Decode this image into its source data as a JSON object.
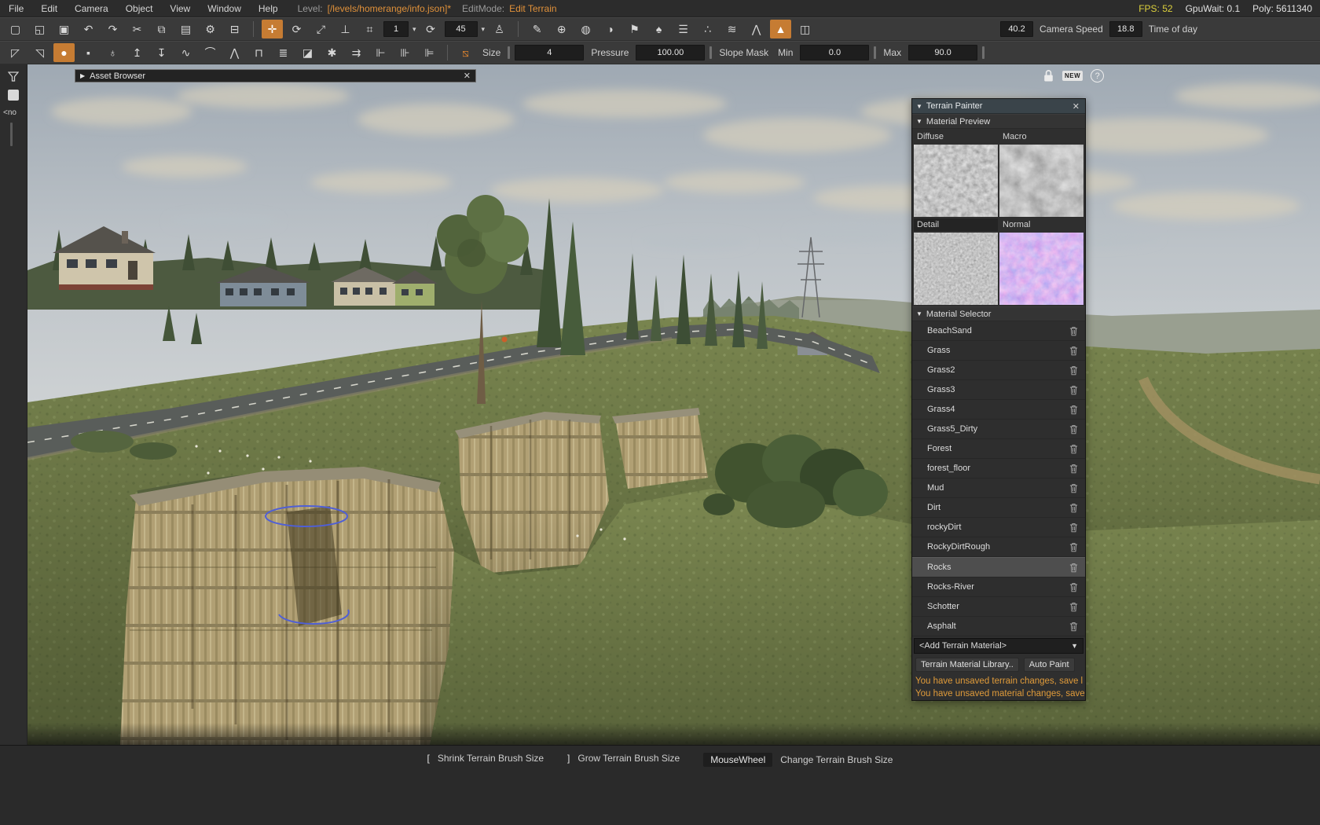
{
  "glyphs": {
    "caret_down": "▾",
    "triangle_right": "▶",
    "triangle_down": "▼",
    "close": "✕"
  },
  "menubar": {
    "items": [
      "File",
      "Edit",
      "Camera",
      "Object",
      "View",
      "Window",
      "Help"
    ],
    "level_label": "Level:",
    "level_value": "[/levels/homerange/info.json]*",
    "editmode_label": "EditMode:",
    "editmode_value": "Edit Terrain",
    "fps": "FPS: 52",
    "gpuwait": "GpuWait: 0.1",
    "poly": "Poly: 5611340"
  },
  "toolbar1": {
    "icons_main": [
      {
        "name": "new-file-icon",
        "glyph": "▢"
      },
      {
        "name": "open-folder-icon",
        "glyph": "◱"
      },
      {
        "name": "save-icon",
        "glyph": "▣"
      },
      {
        "name": "undo-icon",
        "glyph": "↶"
      },
      {
        "name": "redo-icon",
        "glyph": "↷"
      },
      {
        "name": "cut-icon",
        "glyph": "✂"
      },
      {
        "name": "copy-icon",
        "glyph": "⧉"
      },
      {
        "name": "paste-icon",
        "glyph": "▤"
      },
      {
        "name": "settings-icon",
        "glyph": "⚙"
      },
      {
        "name": "vehicle-icon",
        "glyph": "⊟"
      }
    ],
    "icons_transform": [
      {
        "name": "translate-tool-icon",
        "glyph": "✛",
        "active": true
      },
      {
        "name": "rotate-tool-icon",
        "glyph": "⟳"
      },
      {
        "name": "scale-tool-icon",
        "glyph": "⤢"
      },
      {
        "name": "measure-icon",
        "glyph": "⊥"
      },
      {
        "name": "snap-grid-icon",
        "glyph": "⌗"
      }
    ],
    "snap_value": "1",
    "icons_angle": [
      {
        "name": "rotate-snap-icon",
        "glyph": "⟳"
      }
    ],
    "angle_value": "45",
    "icons_mode": [
      {
        "name": "walk-mode-icon",
        "glyph": "♙"
      }
    ],
    "icons_tools": [
      {
        "name": "pencil-tool-icon",
        "glyph": "✎"
      },
      {
        "name": "add-object-icon",
        "glyph": "⊕"
      },
      {
        "name": "sphere-tool-icon",
        "glyph": "◍"
      },
      {
        "name": "paint-tool-icon",
        "glyph": "◑"
      },
      {
        "name": "flag-tool-icon",
        "glyph": "⚑"
      },
      {
        "name": "forest-tool-icon",
        "glyph": "♠"
      },
      {
        "name": "layers-icon",
        "glyph": "☰"
      },
      {
        "name": "scatter-icon",
        "glyph": "∴"
      },
      {
        "name": "river-tool-icon",
        "glyph": "≋"
      },
      {
        "name": "ridge-tool-icon",
        "glyph": "⋀"
      },
      {
        "name": "terrain-editor-icon",
        "glyph": "▲",
        "active": true
      },
      {
        "name": "road-tool-icon",
        "glyph": "◫"
      }
    ],
    "camera_speed_value": "40.2",
    "camera_speed_label": "Camera Speed",
    "time_value": "18.8",
    "time_label": "Time of day"
  },
  "toolbar2": {
    "icons": [
      {
        "name": "select-arrow-icon",
        "glyph": "◸"
      },
      {
        "name": "select-region-icon",
        "glyph": "◹"
      },
      {
        "name": "round-brush-icon",
        "glyph": "●",
        "active": true
      },
      {
        "name": "square-brush-icon",
        "glyph": "▪"
      },
      {
        "name": "height-probe-icon",
        "glyph": "♁"
      },
      {
        "name": "raise-height-icon",
        "glyph": "↥"
      },
      {
        "name": "lower-height-icon",
        "glyph": "↧"
      },
      {
        "name": "smooth-icon",
        "glyph": "∿"
      },
      {
        "name": "smooth-slope-icon",
        "glyph": "⌒"
      },
      {
        "name": "noise-icon",
        "glyph": "⋀"
      },
      {
        "name": "flatten-icon",
        "glyph": "⊓"
      },
      {
        "name": "set-height-icon",
        "glyph": "≣"
      },
      {
        "name": "erase-icon",
        "glyph": "◪"
      },
      {
        "name": "paint-noise-icon",
        "glyph": "✱"
      },
      {
        "name": "flow-icon",
        "glyph": "⇉"
      },
      {
        "name": "mask-tool-1-icon",
        "glyph": "⊩"
      },
      {
        "name": "mask-tool-2-icon",
        "glyph": "⊪"
      },
      {
        "name": "mask-tool-3-icon",
        "glyph": "⊫"
      },
      {
        "name": "toolbar-divider",
        "glyph": "",
        "divider": true
      },
      {
        "name": "slope-mask-icon",
        "glyph": "⧅",
        "accent": true
      }
    ],
    "size_label": "Size",
    "size_value": "4",
    "pressure_label": "Pressure",
    "pressure_value": "100.00",
    "slope_label": "Slope Mask",
    "min_label": "Min",
    "min_value": "0.0",
    "max_label": "Max",
    "max_value": "90.0"
  },
  "left_panel": {
    "collapsed_label": "<no"
  },
  "asset_browser": {
    "title": "Asset Browser"
  },
  "viewport_overlay": {
    "new_badge": "NEW",
    "help": "?"
  },
  "terrain_painter": {
    "title": "Terrain Painter",
    "sections": {
      "preview": "Material Preview",
      "selector": "Material Selector"
    },
    "preview_labels": {
      "diffuse": "Diffuse",
      "macro": "Macro",
      "detail": "Detail",
      "normal": "Normal"
    },
    "materials": [
      {
        "label": "BeachSand"
      },
      {
        "label": "Grass"
      },
      {
        "label": "Grass2"
      },
      {
        "label": "Grass3"
      },
      {
        "label": "Grass4"
      },
      {
        "label": "Grass5_Dirty"
      },
      {
        "label": "Forest"
      },
      {
        "label": "forest_floor"
      },
      {
        "label": "Mud"
      },
      {
        "label": "Dirt"
      },
      {
        "label": "rockyDirt"
      },
      {
        "label": "RockyDirtRough"
      },
      {
        "label": "Rocks",
        "selected": true
      },
      {
        "label": "Rocks-River"
      },
      {
        "label": "Schotter"
      },
      {
        "label": "Asphalt"
      }
    ],
    "add_material": "<Add Terrain Material>",
    "library_button": "Terrain Material Library..",
    "auto_paint_button": "Auto Paint",
    "warnings": [
      "You have unsaved terrain changes, save l",
      "You have unsaved material changes, save"
    ]
  },
  "statusbar": {
    "shortcuts": [
      {
        "key": "[",
        "label": "Shrink Terrain Brush Size"
      },
      {
        "key": "]",
        "label": "Grow Terrain Brush Size"
      },
      {
        "key": "MouseWheel",
        "label": "Change Terrain Brush Size",
        "boxed": true
      }
    ]
  },
  "colors": {
    "accent_orange": "#c67c33",
    "warning_orange": "#e09b3a",
    "fps_yellow": "#ddd13c",
    "panel_header": "#3a444a"
  }
}
